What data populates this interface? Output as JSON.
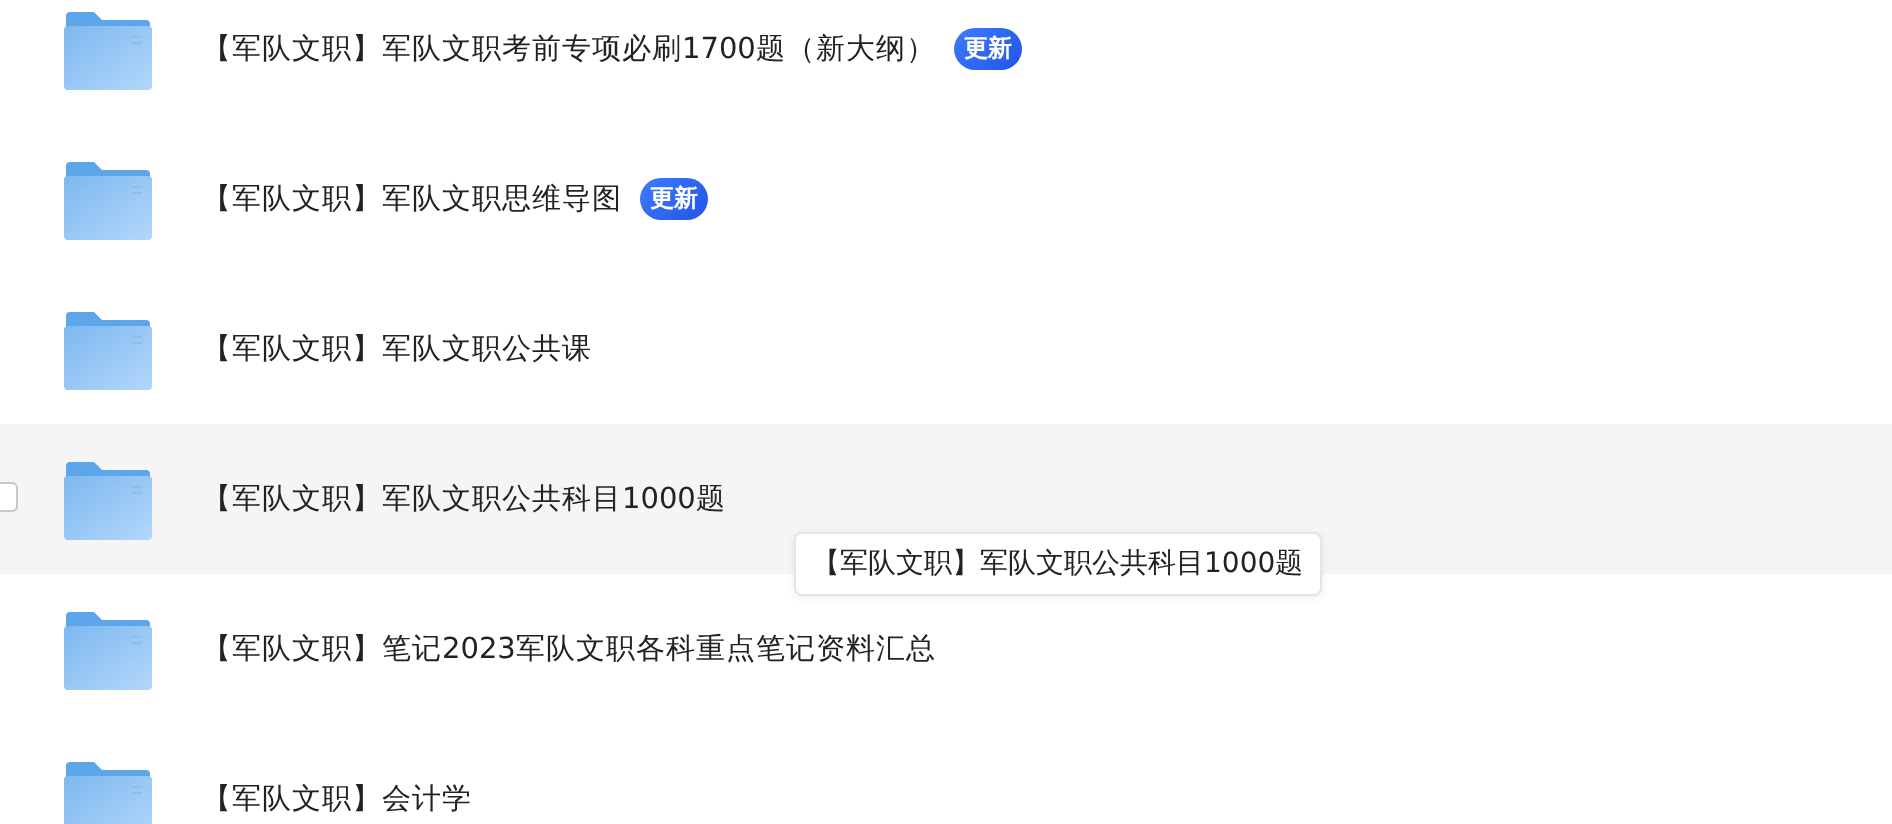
{
  "files": [
    {
      "name": "【军队文职】军队文职考前专项必刷1700题（新大纲）",
      "badge": "更新",
      "hovered": false
    },
    {
      "name": "【军队文职】军队文职思维导图",
      "badge": "更新",
      "hovered": false
    },
    {
      "name": "【军队文职】军队文职公共课",
      "hovered": false
    },
    {
      "name": "【军队文职】军队文职公共科目1000题",
      "hovered": true
    },
    {
      "name": "【军队文职】笔记2023军队文职各科重点笔记资料汇总",
      "hovered": false
    },
    {
      "name": "【军队文职】会计学",
      "hovered": false
    }
  ],
  "tooltip": {
    "text": "【军队文职】军队文职公共科目1000题"
  }
}
